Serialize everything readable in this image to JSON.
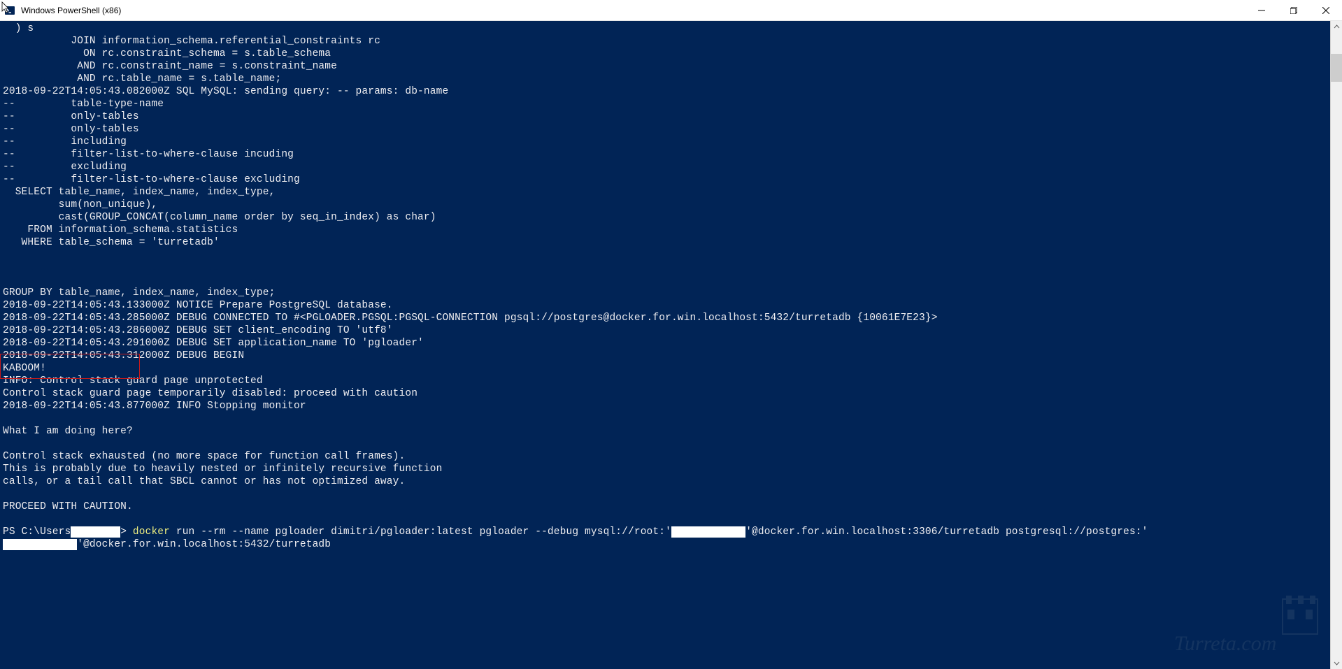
{
  "window": {
    "title": "Windows PowerShell (x86)"
  },
  "terminal": {
    "lines": [
      "  ) s",
      "           JOIN information_schema.referential_constraints rc",
      "             ON rc.constraint_schema = s.table_schema",
      "            AND rc.constraint_name = s.constraint_name",
      "            AND rc.table_name = s.table_name;",
      "2018-09-22T14:05:43.082000Z SQL MySQL: sending query: -- params: db-name",
      "--         table-type-name",
      "--         only-tables",
      "--         only-tables",
      "--         including",
      "--         filter-list-to-where-clause incuding",
      "--         excluding",
      "--         filter-list-to-where-clause excluding",
      "  SELECT table_name, index_name, index_type,",
      "         sum(non_unique),",
      "         cast(GROUP_CONCAT(column_name order by seq_in_index) as char)",
      "    FROM information_schema.statistics",
      "   WHERE table_schema = 'turretadb'",
      "",
      "",
      "",
      "GROUP BY table_name, index_name, index_type;",
      "2018-09-22T14:05:43.133000Z NOTICE Prepare PostgreSQL database.",
      "2018-09-22T14:05:43.285000Z DEBUG CONNECTED TO #<PGLOADER.PGSQL:PGSQL-CONNECTION pgsql://postgres@docker.for.win.localhost:5432/turretadb {10061E7E23}>",
      "2018-09-22T14:05:43.286000Z DEBUG SET client_encoding TO 'utf8'",
      "2018-09-22T14:05:43.291000Z DEBUG SET application_name TO 'pgloader'",
      "2018-09-22T14:05:43.312000Z DEBUG BEGIN",
      "KABOOM!",
      "INFO: Control stack guard page unprotected",
      "Control stack guard page temporarily disabled: proceed with caution",
      "2018-09-22T14:05:43.877000Z INFO Stopping monitor",
      "",
      "What I am doing here?",
      "",
      "Control stack exhausted (no more space for function call frames).",
      "This is probably due to heavily nested or infinitely recursive function",
      "calls, or a tail call that SBCL cannot or has not optimized away.",
      "",
      "PROCEED WITH CAUTION.",
      ""
    ],
    "prompt": {
      "prefix": "PS C:\\Users",
      "redacted1": "\\xxxxxxx",
      "sep": "> ",
      "cmd": "docker",
      "args_part1": " run --rm --name pgloader dimitri/pgloader:latest pgloader --debug mysql://root:'",
      "redacted2": "xxxxxxxxxxxx",
      "args_part2": "'@docker.for.win.localhost:3306/turretadb postgresql://postgres:'",
      "continuation_redacted": "xxxxxxxxxxxx",
      "continuation_rest": "'@docker.for.win.localhost:5432/turretadb"
    }
  }
}
